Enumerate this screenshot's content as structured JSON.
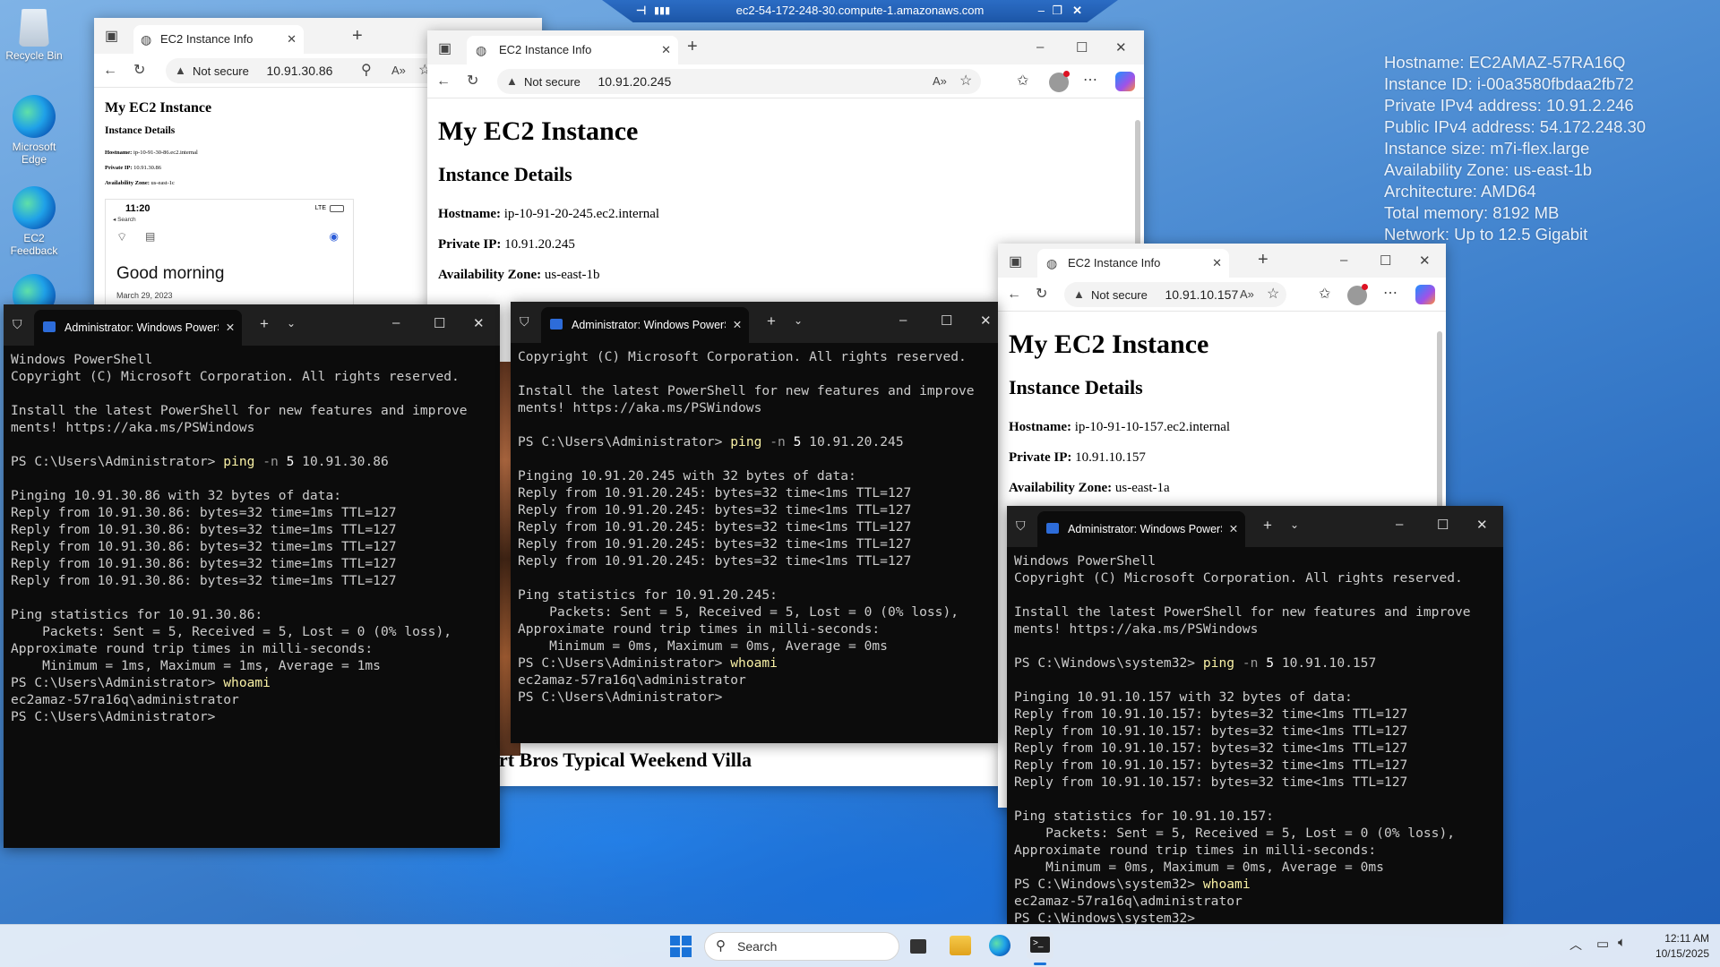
{
  "rdp_title": "ec2-54-172-248-30.compute-1.amazonaws.com",
  "desktop_icons": [
    "Recycle Bin",
    "Microsoft Edge",
    "EC2 Feedback"
  ],
  "sysinfo": [
    "Hostname: EC2AMAZ-57RA16Q",
    "Instance ID: i-00a3580fbdaa2fb72",
    "Private IPv4 address: 10.91.2.246",
    "Public IPv4 address: 54.172.248.30",
    "Instance size: m7i-flex.large",
    "Availability Zone: us-east-1b",
    "Architecture: AMD64",
    "Total memory: 8192 MB",
    "Network: Up to 12.5 Gigabit"
  ],
  "browser_a": {
    "tab": "EC2 Instance Info",
    "not_secure": "Not secure",
    "url": "10.91.30.86",
    "h1": "My EC2 Instance",
    "h2": "Instance Details",
    "hostname_label": "Hostname:",
    "hostname": "ip-10-91-30-86.ec2.internal",
    "ip_label": "Private IP:",
    "ip": "10.91.30.86",
    "az_label": "Availability Zone:",
    "az": "us-east-1c",
    "phone_time": "11:20",
    "phone_back": "◂ Search",
    "phone_greeting": "Good morning",
    "phone_date": "March 29, 2023",
    "phone_net": "LTE"
  },
  "browser_b": {
    "tab": "EC2 Instance Info",
    "not_secure": "Not secure",
    "url": "10.91.20.245",
    "h1": "My EC2 Instance",
    "h2": "Instance Details",
    "hostname_label": "Hostname:",
    "hostname": "ip-10-91-20-245.ec2.internal",
    "ip_label": "Private IP:",
    "ip": "10.91.20.245",
    "az_label": "Availability Zone:",
    "az": "us-east-1b",
    "bottom_text": "rt Bros Typical Weekend Villa"
  },
  "browser_c": {
    "tab": "EC2 Instance Info",
    "not_secure": "Not secure",
    "url": "10.91.10.157",
    "h1": "My EC2 Instance",
    "h2": "Instance Details",
    "hostname_label": "Hostname:",
    "hostname": "ip-10-91-10-157.ec2.internal",
    "ip_label": "Private IP:",
    "ip": "10.91.10.157",
    "az_label": "Availability Zone:",
    "az": "us-east-1a"
  },
  "term_a": {
    "tab": "Administrator: Windows PowerShell",
    "l1": "Windows PowerShell",
    "l2": "Copyright (C) Microsoft Corporation. All rights reserved.",
    "l3": "Install the latest PowerShell for new features and improve",
    "l4": "ments! https://aka.ms/PSWindows",
    "prompt": "PS C:\\Users\\Administrator>",
    "cmd": "ping",
    "flag": "-n",
    "num": "5",
    "target": "10.91.30.86",
    "pinging": "Pinging 10.91.30.86 with 32 bytes of data:",
    "reply": "Reply from 10.91.30.86: bytes=32 time=1ms TTL=127",
    "stats": "Ping statistics for 10.91.30.86:",
    "packets": "    Packets: Sent = 5, Received = 5, Lost = 0 (0% loss),",
    "approx": "Approximate round trip times in milli-seconds:",
    "minmax": "    Minimum = 1ms, Maximum = 1ms, Average = 1ms",
    "whoami": "whoami",
    "user": "ec2amaz-57ra16q\\administrator"
  },
  "term_b": {
    "tab": "Administrator: Windows PowerShell",
    "l2": "Copyright (C) Microsoft Corporation. All rights reserved.",
    "l3": "Install the latest PowerShell for new features and improve",
    "l4": "ments! https://aka.ms/PSWindows",
    "prompt": "PS C:\\Users\\Administrator>",
    "cmd": "ping",
    "flag": "-n",
    "num": "5",
    "target": "10.91.20.245",
    "pinging": "Pinging 10.91.20.245 with 32 bytes of data:",
    "reply": "Reply from 10.91.20.245: bytes=32 time<1ms TTL=127",
    "stats": "Ping statistics for 10.91.20.245:",
    "packets": "    Packets: Sent = 5, Received = 5, Lost = 0 (0% loss),",
    "approx": "Approximate round trip times in milli-seconds:",
    "minmax": "    Minimum = 0ms, Maximum = 0ms, Average = 0ms",
    "whoami": "whoami",
    "user": "ec2amaz-57ra16q\\administrator"
  },
  "term_c": {
    "tab": "Administrator: Windows PowerShell",
    "l1": "Windows PowerShell",
    "l2": "Copyright (C) Microsoft Corporation. All rights reserved.",
    "l3": "Install the latest PowerShell for new features and improve",
    "l4": "ments! https://aka.ms/PSWindows",
    "prompt": "PS C:\\Windows\\system32>",
    "cmd": "ping",
    "flag": "-n",
    "num": "5",
    "target": "10.91.10.157",
    "pinging": "Pinging 10.91.10.157 with 32 bytes of data:",
    "reply": "Reply from 10.91.10.157: bytes=32 time<1ms TTL=127",
    "stats": "Ping statistics for 10.91.10.157:",
    "packets": "    Packets: Sent = 5, Received = 5, Lost = 0 (0% loss),",
    "approx": "Approximate round trip times in milli-seconds:",
    "minmax": "    Minimum = 0ms, Maximum = 0ms, Average = 0ms",
    "whoami": "whoami",
    "user": "ec2amaz-57ra16q\\administrator"
  },
  "taskbar": {
    "search": "Search",
    "time": "12:11 AM",
    "date": "10/15/2025"
  }
}
